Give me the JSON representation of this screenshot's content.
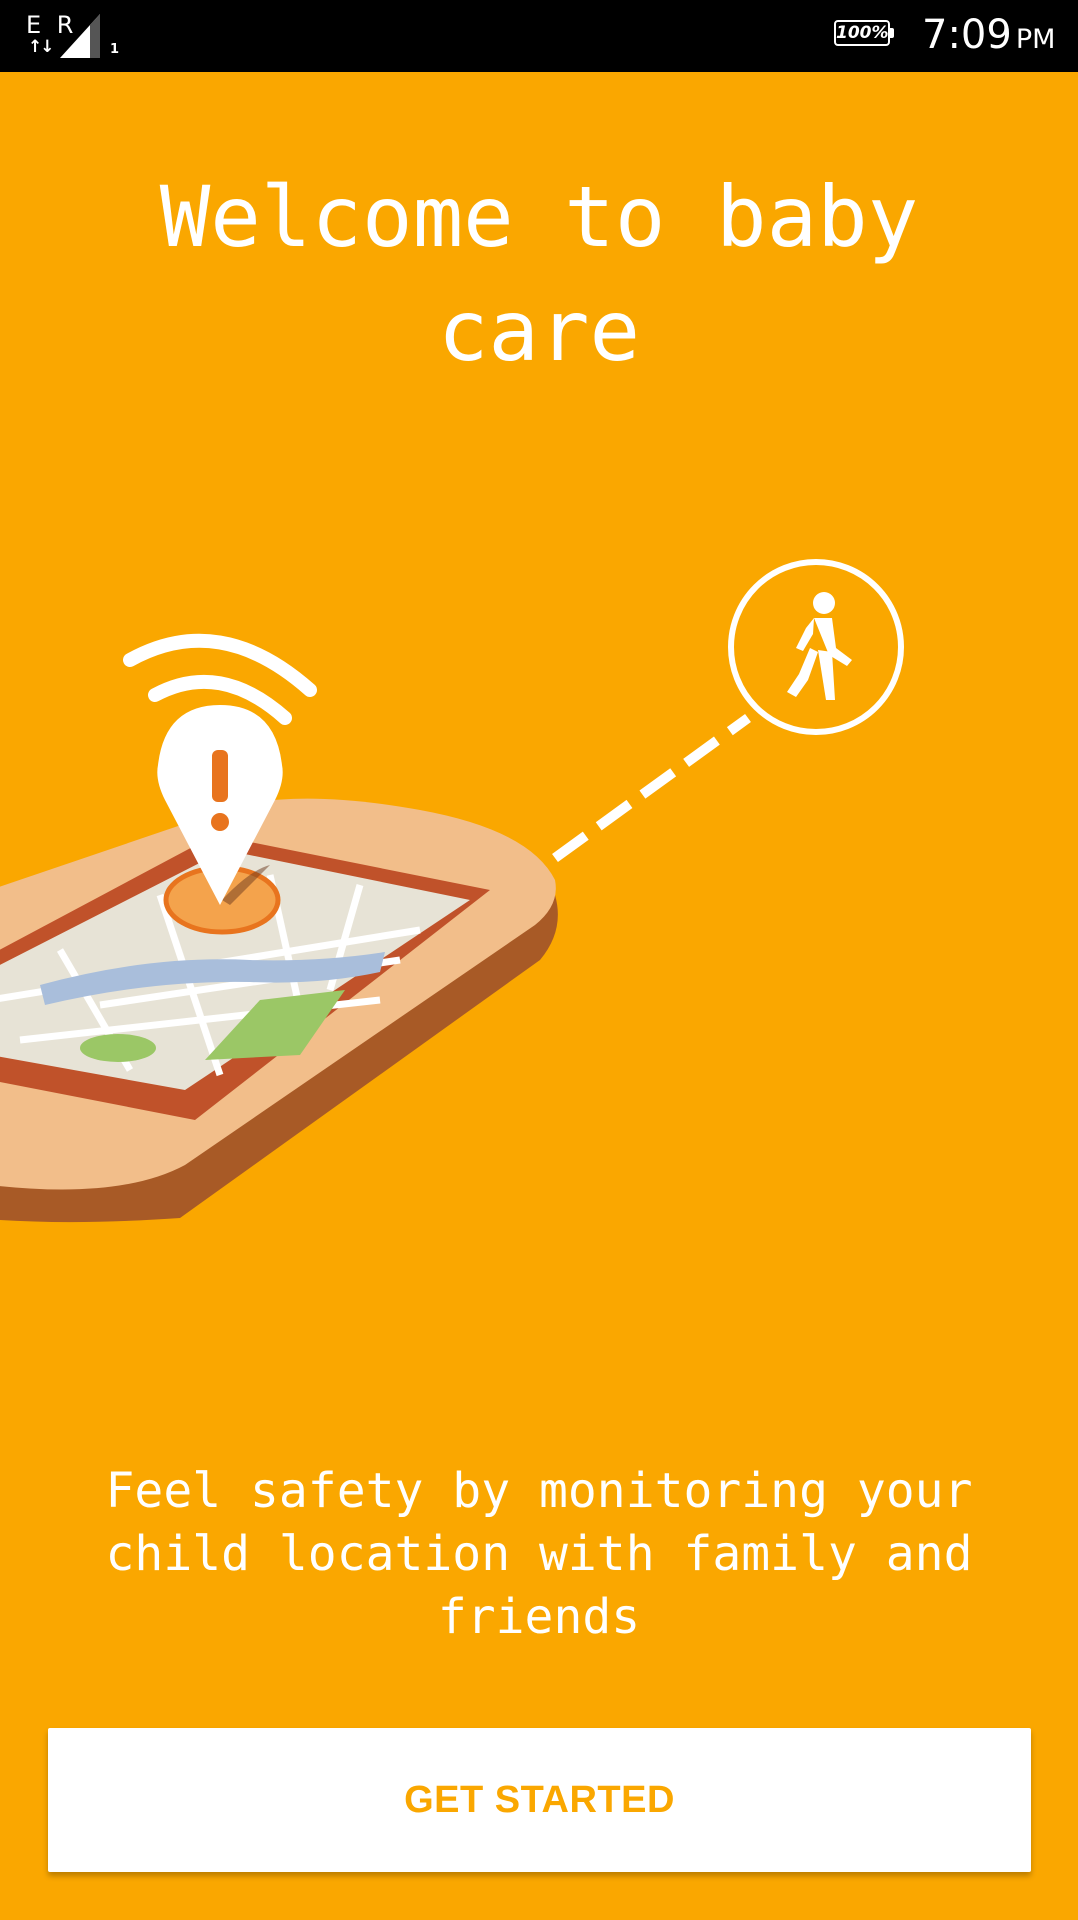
{
  "status_bar": {
    "network_letters": "E R",
    "network_arrows": "↑↓",
    "sim_slot": "1",
    "battery": "100%",
    "time": "7:09",
    "ampm": "PM"
  },
  "welcome": {
    "title": "Welcome to baby care",
    "tagline": "Feel safety by monitoring your child location with family and friends",
    "cta_label": "GET STARTED"
  },
  "colors": {
    "background": "#FAA700",
    "button_background": "#FFFFFF",
    "button_text": "#FAA700"
  },
  "icons": {
    "illustration": "phone-map-location-illustration",
    "alert_pin": "location-alert-pin-icon",
    "walker": "walking-person-icon"
  }
}
